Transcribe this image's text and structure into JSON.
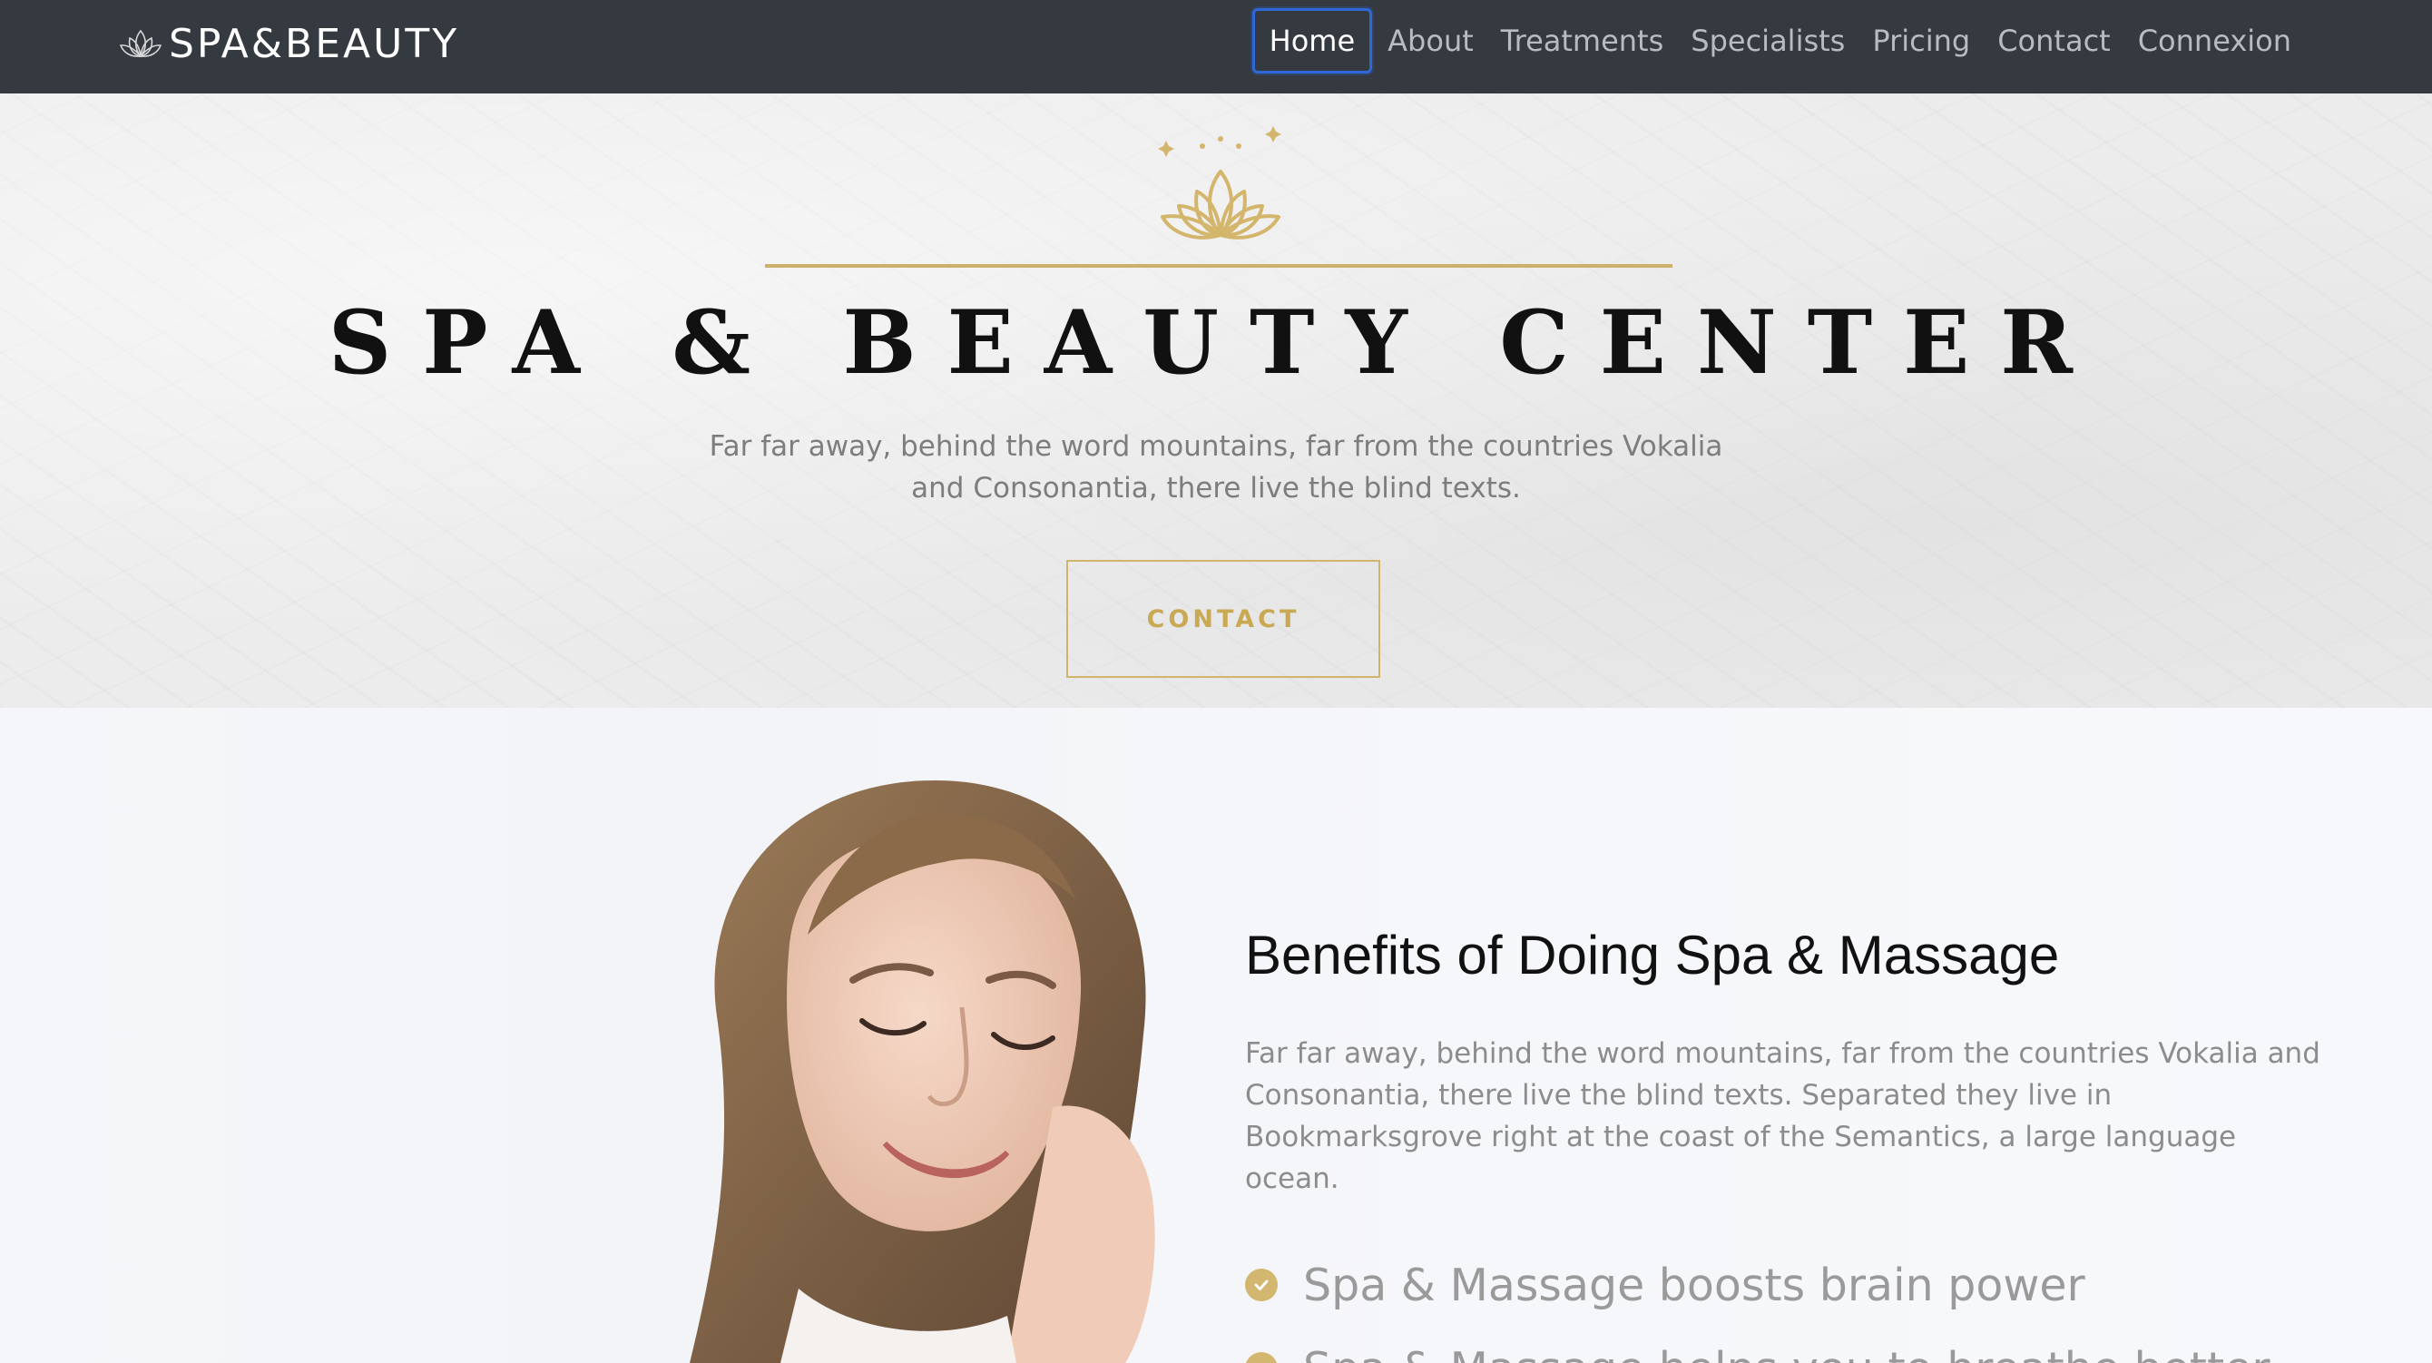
{
  "navbar": {
    "brand": "SPA&BEAUTY",
    "brand_icon": "lotus-icon",
    "items": [
      {
        "label": "Home",
        "active": true
      },
      {
        "label": "About"
      },
      {
        "label": "Treatments"
      },
      {
        "label": "Specialists"
      },
      {
        "label": "Pricing"
      },
      {
        "label": "Contact"
      },
      {
        "label": "Connexion"
      }
    ]
  },
  "hero": {
    "icon": "lotus-icon",
    "title": "SPA & BEAUTY CENTER",
    "text": "Far far away, behind the word mountains, far from the countries Vokalia and Consonantia, there live the blind texts.",
    "button": "CONTACT"
  },
  "benefits": {
    "title": "Benefits of Doing Spa & Massage",
    "text": "Far far away, behind the word mountains, far from the countries Vokalia and Consonantia, there live the blind texts. Separated they live in Bookmarksgrove right at the coast of the Semantics, a large language ocean.",
    "items": [
      "Spa & Massage boosts brain power",
      "Spa & Massage helps you to breathe better"
    ]
  },
  "colors": {
    "navbar_bg": "#343a40",
    "accent_gold": "#cdb06a",
    "active_outline": "#2f68d8"
  }
}
